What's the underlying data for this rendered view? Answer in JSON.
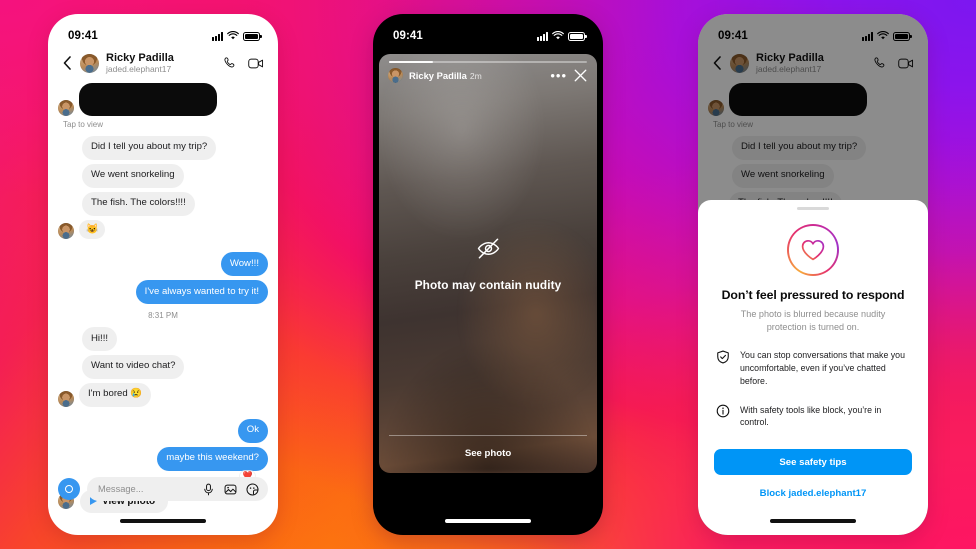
{
  "background": {
    "gradient_from": "#8019F0",
    "gradient_mid": "#F0187E",
    "gradient_to": "#FAB314"
  },
  "phone1": {
    "status": {
      "time": "09:41"
    },
    "header": {
      "back_icon": "chevron-left-icon",
      "name": "Ricky Padilla",
      "handle": "jaded.elephant17",
      "call_icon": "phone-icon",
      "video_icon": "video-camera-icon"
    },
    "hidden_photo_caption": "Tap to view",
    "messages": [
      {
        "side": "in",
        "text": "Did I tell you about my trip?"
      },
      {
        "side": "in",
        "text": "We went snorkeling"
      },
      {
        "side": "in",
        "text": "The fish. The colors!!!!"
      },
      {
        "side": "in",
        "text": "😺",
        "emoji": true
      }
    ],
    "messages_out_1": [
      {
        "side": "out",
        "text": "Wow!!!"
      },
      {
        "side": "out",
        "text": "I've always wanted to try it!"
      }
    ],
    "timestamp": "8:31 PM",
    "messages2": [
      {
        "side": "in",
        "text": "Hi!!!"
      },
      {
        "side": "in",
        "text": "Want to video chat?"
      },
      {
        "side": "in",
        "text": "I'm bored 😢"
      }
    ],
    "messages_out_2": [
      {
        "side": "out",
        "text": "Ok"
      },
      {
        "side": "out",
        "text": "maybe this weekend?"
      }
    ],
    "reaction": "❤️",
    "view_photo_label": "View photo",
    "composer": {
      "camera_icon": "camera-icon",
      "placeholder": "Message...",
      "mic_icon": "microphone-icon",
      "gallery_icon": "image-icon",
      "sticker_icon": "sticker-icon"
    }
  },
  "phone2": {
    "status": {
      "time": "09:41"
    },
    "story": {
      "user": "Ricky Padilla",
      "ago": "2m",
      "more_icon": "ellipsis-icon",
      "close_icon": "close-icon",
      "nudity_icon": "eye-slash-icon",
      "nudity_warning": "Photo may contain nudity",
      "see_photo_label": "See photo"
    }
  },
  "phone3": {
    "status": {
      "time": "09:41"
    },
    "header": {
      "back_icon": "chevron-left-icon",
      "name": "Ricky Padilla",
      "handle": "jaded.elephant17",
      "call_icon": "phone-icon",
      "video_icon": "video-camera-icon"
    },
    "hidden_photo_caption": "Tap to view",
    "messages": [
      {
        "side": "in",
        "text": "Did I tell you about my trip?"
      },
      {
        "side": "in",
        "text": "We went snorkeling"
      },
      {
        "side": "in",
        "text": "The fish. The colors!!!!"
      }
    ],
    "sheet": {
      "heart_icon": "heart-icon",
      "title": "Don’t feel pressured to respond",
      "subtitle": "The photo is blurred because nudity protection is turned on.",
      "tips": [
        {
          "icon": "shield-check-icon",
          "text": "You can stop conversations that make you uncomfortable, even if you’ve chatted before."
        },
        {
          "icon": "info-circle-icon",
          "text": "With safety tools like block, you’re in control."
        }
      ],
      "cta_label": "See safety tips",
      "link_label": "Block jaded.elephant17",
      "accent_color": "#0095F6"
    }
  }
}
